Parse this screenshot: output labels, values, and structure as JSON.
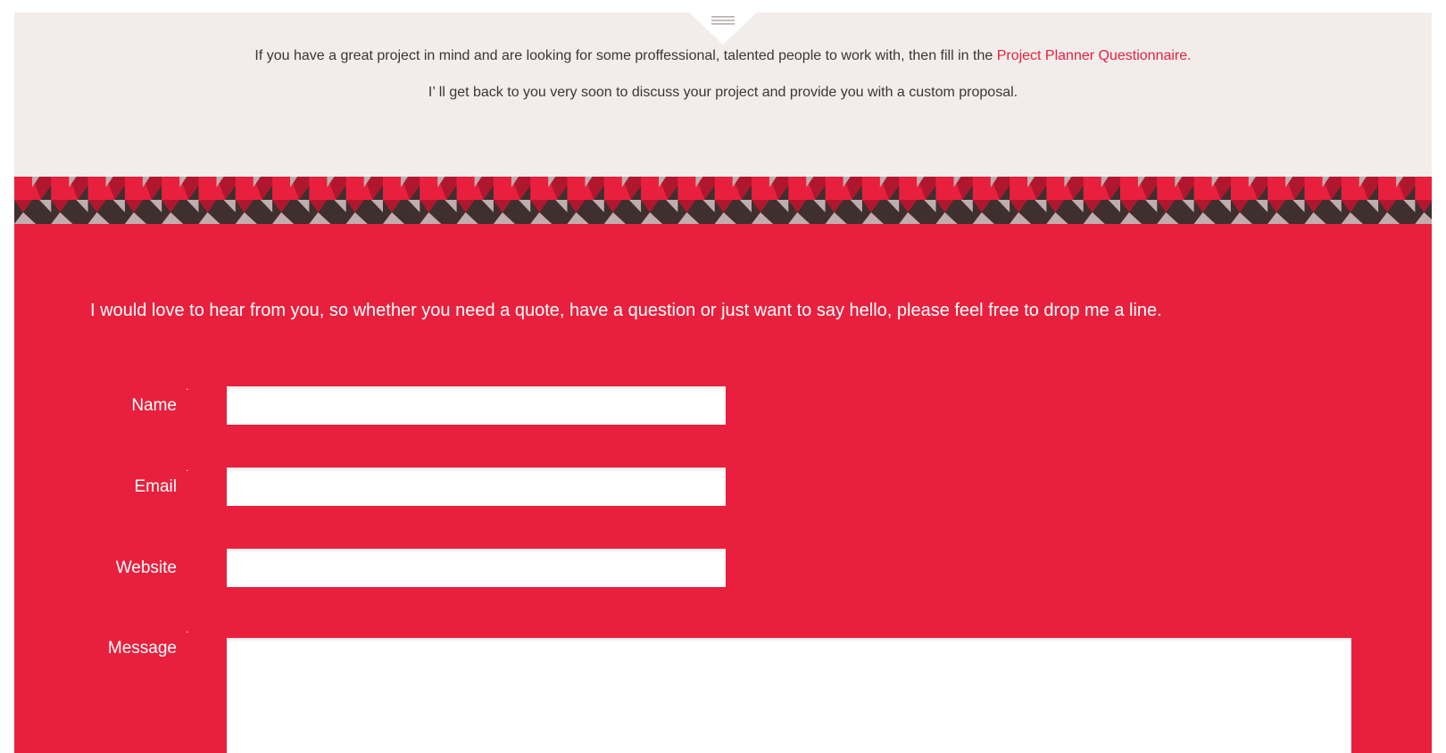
{
  "intro": {
    "line1_text": "If you have a great project in mind and are looking for some proffessional, talented people to work with, then fill in the ",
    "line1_link": "Project Planner Questionnaire.",
    "line2_text": "I’ ll get back to you very soon to discuss your project and provide you with a custom proposal."
  },
  "menu": {
    "icon": "hamburger-menu-icon"
  },
  "contact": {
    "intro_text": "I would love to hear from you, so whether you need a quote, have a question or just want to say hello, please feel free to drop me a line.",
    "required_marker": "˙",
    "fields": {
      "name": {
        "label": "Name",
        "value": "",
        "placeholder": ""
      },
      "email": {
        "label": "Email",
        "value": "",
        "placeholder": ""
      },
      "website": {
        "label": "Website",
        "value": "",
        "placeholder": ""
      },
      "message": {
        "label": "Message",
        "value": "",
        "placeholder": ""
      }
    }
  },
  "colors": {
    "intro_bg": "#f2edeb",
    "accent_red": "#e8203d",
    "dark_maroon": "#3f2f2f",
    "deep_red": "#b0172e",
    "pattern_grey": "#c0aeae",
    "text_dark": "#3d3434"
  }
}
